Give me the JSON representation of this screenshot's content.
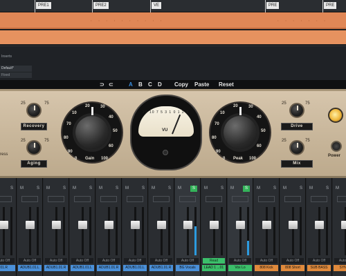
{
  "timeline": {
    "markers": [
      "PRE1",
      "PRE2",
      "VE",
      "PRE",
      "PRE"
    ]
  },
  "inspector": {
    "label": "Inserts",
    "preset": "Default*",
    "preset_sub": "Fixed"
  },
  "toolbar": {
    "undo": "⊃",
    "redo": "⊂",
    "slot_a": "A",
    "slot_b": "B",
    "slot_c": "C",
    "slot_d": "D",
    "copy": "Copy",
    "paste": "Paste",
    "reset": "Reset"
  },
  "plugin": {
    "recovery_label": "Recovery",
    "aging_label": "Aging",
    "drive_label": "Drive",
    "mix_label": "Mix",
    "gain_label": "Gain",
    "peak_label": "Peak",
    "power_label": "Power",
    "ress_label": "ress",
    "vu_label": "VU",
    "vu_scale": "20 10 7 5 3 1 0 1 2 3",
    "small_scale_lo": "25",
    "small_scale_hi": "75",
    "gain_dial": [
      "10",
      "20",
      "30",
      "40",
      "50",
      "60",
      "70",
      "80",
      "90",
      "0",
      "100"
    ],
    "peak_dial": [
      "10",
      "20",
      "30",
      "40",
      "50",
      "60",
      "70",
      "80",
      "90",
      "0",
      "100"
    ],
    "colors": {
      "panel": "#c6b498",
      "lamp": "#f0b93e",
      "accent": "#3a8fe0"
    }
  },
  "mixer": {
    "channels": [
      {
        "m": "M",
        "s": "S",
        "auto": "Auto Off",
        "name": ".01.R",
        "color": "#4a90d9",
        "solo": false,
        "level": 0
      },
      {
        "m": "M",
        "s": "S",
        "auto": "Auto Off",
        "name": "ADUB1.01.L",
        "color": "#4a90d9",
        "solo": false,
        "level": 0
      },
      {
        "m": "M",
        "s": "S",
        "auto": "Auto Off",
        "name": "ADUB1.01.R",
        "color": "#4a90d9",
        "solo": false,
        "level": 0
      },
      {
        "m": "M",
        "s": "S",
        "auto": "Auto Off",
        "name": "ADUB1.01.L",
        "color": "#4a90d9",
        "solo": false,
        "level": 0
      },
      {
        "m": "M",
        "s": "S",
        "auto": "Auto Off",
        "name": "ADUB1.01.R",
        "color": "#4a90d9",
        "solo": false,
        "level": 0
      },
      {
        "m": "M",
        "s": "S",
        "auto": "Auto Off",
        "name": "ADUB1.01.L",
        "color": "#4a90d9",
        "solo": false,
        "level": 0
      },
      {
        "m": "M",
        "s": "S",
        "auto": "Auto Off",
        "name": "ADUB1.01.R",
        "color": "#4a90d9",
        "solo": false,
        "level": 0
      },
      {
        "m": "M",
        "s": "S",
        "auto": "Auto Off",
        "name": "BG Vocals",
        "color": "#4a90d9",
        "solo": true,
        "level": 0.6
      },
      {
        "m": "M",
        "s": "S",
        "auto": "Read",
        "name": "LEAD 1 ...01",
        "color": "#3bbf6a",
        "solo": false,
        "level": 0
      },
      {
        "m": "M",
        "s": "S",
        "auto": "Auto Off",
        "name": "Vox Lo",
        "color": "#3bbf6a",
        "solo": true,
        "level": 0.3
      },
      {
        "m": "M",
        "s": "S",
        "auto": "Auto Off",
        "name": "808 Kick",
        "color": "#e08a3c",
        "solo": false,
        "level": 0
      },
      {
        "m": "M",
        "s": "S",
        "auto": "Auto Off",
        "name": "808 Short",
        "color": "#e08a3c",
        "solo": false,
        "level": 0
      },
      {
        "m": "M",
        "s": "S",
        "auto": "Auto Off",
        "name": "SUB BASS",
        "color": "#e08a3c",
        "solo": false,
        "level": 0
      },
      {
        "m": "M",
        "s": "S",
        "auto": "Auto Off",
        "name": "SYNTH",
        "color": "#e08a3c",
        "solo": false,
        "level": 0
      }
    ]
  }
}
